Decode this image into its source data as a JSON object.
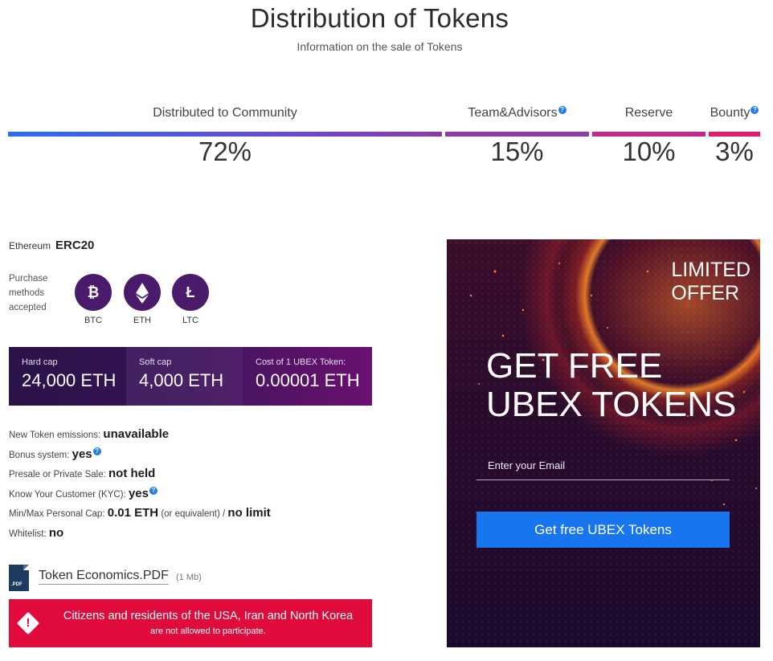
{
  "header": {
    "title": "Distribution of Tokens",
    "subtitle": "Information on the sale of Tokens"
  },
  "distribution": [
    {
      "label": "Distributed to Community",
      "percent": "72%",
      "value": 72,
      "info": false,
      "color": "#2a6df0"
    },
    {
      "label": "Team&Advisors",
      "percent": "15%",
      "value": 15,
      "info": true,
      "color": "#8b3aa6"
    },
    {
      "label": "Reserve",
      "percent": "10%",
      "value": 10,
      "info": false,
      "color": "#c02a8a"
    },
    {
      "label": "Bounty",
      "percent": "3%",
      "value": 3,
      "info": true,
      "color": "#e21a6a"
    }
  ],
  "standard": {
    "label": "Ethereum",
    "value": "ERC20"
  },
  "purchase": {
    "label_lines": [
      "Purchase",
      "methods",
      "accepted"
    ],
    "coins": [
      {
        "symbol": "BTC",
        "icon": "bitcoin-icon"
      },
      {
        "symbol": "ETH",
        "icon": "ethereum-icon"
      },
      {
        "symbol": "LTC",
        "icon": "litecoin-icon"
      }
    ]
  },
  "caps": [
    {
      "key": "Hard cap",
      "value": "24,000 ETH"
    },
    {
      "key": "Soft cap",
      "value": "4,000 ETH"
    },
    {
      "key": "Cost of 1 UBEX Token:",
      "value": "0.00001 ETH"
    }
  ],
  "facts": {
    "emissions": {
      "label": "New Token emissions:",
      "value": "unavailable"
    },
    "bonus": {
      "label": "Bonus system:",
      "value": "yes"
    },
    "presale": {
      "label": "Presale or Private Sale:",
      "value": "not held"
    },
    "kyc": {
      "label": "Know Your Customer (KYC):",
      "value": "yes"
    },
    "cap": {
      "label": "Min/Max Personal Cap:",
      "min": "0.01 ETH",
      "note": "(or equivalent) /",
      "max": "no limit"
    },
    "whitelist": {
      "label": "Whitelist:",
      "value": "no"
    }
  },
  "document": {
    "icon_text": ".PDF",
    "name": "Token Economics.PDF",
    "size": "(1 Mb)"
  },
  "warning": {
    "line1": "Citizens and residents of the USA, Iran and North Korea",
    "line2": "are not allowed to participate."
  },
  "offer": {
    "badge_line1": "LIMITED",
    "badge_line2": "OFFER",
    "headline_line1": "GET FREE",
    "headline_line2": "UBEX TOKENS",
    "email_placeholder": "Enter your Email",
    "button_label": "Get free UBEX Tokens"
  }
}
